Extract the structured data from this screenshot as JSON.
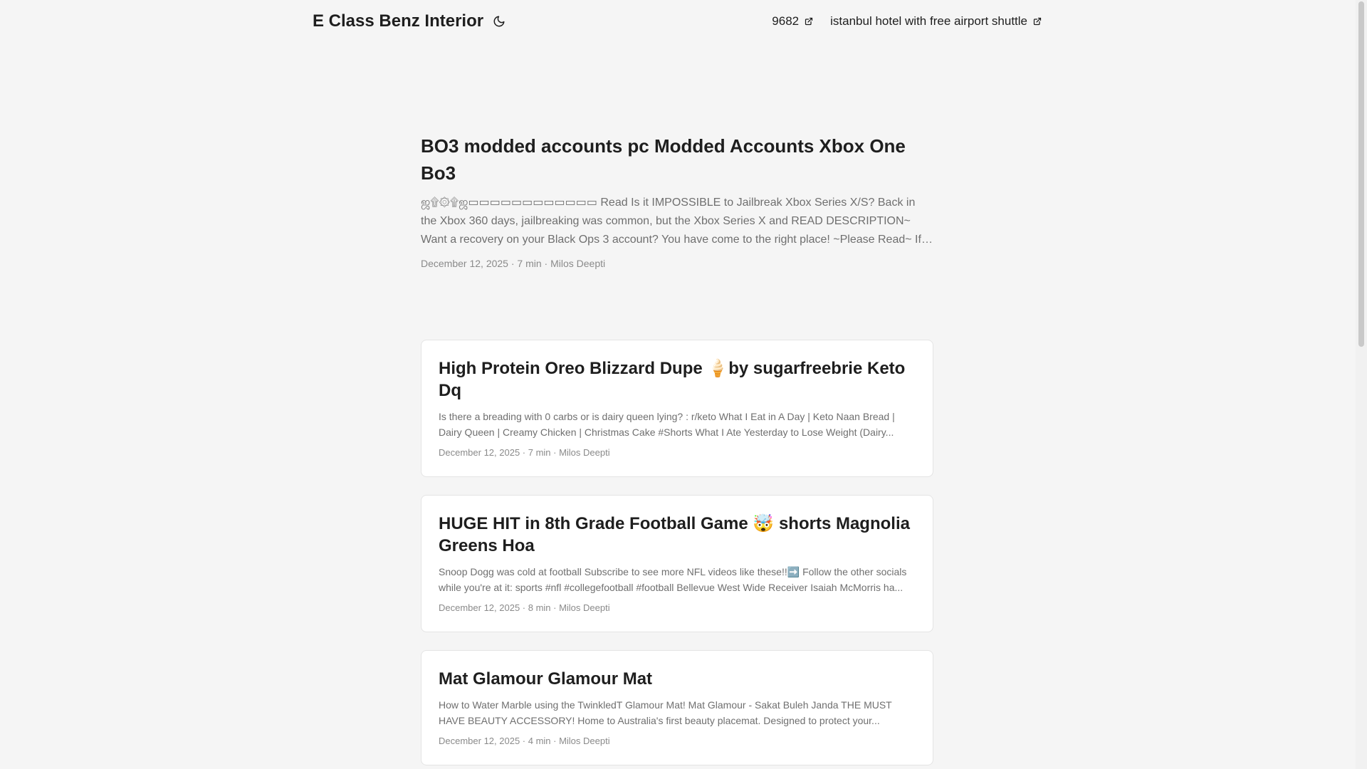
{
  "header": {
    "title": "E Class Benz Interior",
    "theme_icon": "moon-icon",
    "nav": [
      {
        "label": "9682",
        "icon": "external-link-icon"
      },
      {
        "label": "istanbul hotel with free airport shuttle",
        "icon": "external-link-icon"
      }
    ]
  },
  "hero": {
    "title": "BO3 modded accounts pc Modded Accounts Xbox One Bo3",
    "excerpt": "ஜ۩۞۩ஜ▭▭▭▭▭▭▭▭▭▭▭▭ Read Is it IMPOSSIBLE to Jailbreak Xbox Series X/S? Back in the Xbox 360 days, jailbreaking was common, but the Xbox Series X and READ DESCRIPTION~ Want a recovery on your Black Ops 3 account? You have come to the right place! ~Please Read~ If you...",
    "meta": "December 12, 2025 · 7 min · Milos Deepti"
  },
  "posts": [
    {
      "title": "High Protein Oreo Blizzard Dupe 🍦by sugarfreebrie Keto Dq",
      "excerpt": "Is there a breading with 0 carbs or is dairy queen lying? : r/keto What I Eat in A Day | Keto Naan Bread | Dairy Queen | Creamy Chicken | Christmas Cake #Shorts What I Ate Yesterday to Lose Weight (Dairy...",
      "meta": "December 12, 2025 · 7 min · Milos Deepti"
    },
    {
      "title": "HUGE HIT in 8th Grade Football Game 🤯 shorts Magnolia Greens Hoa",
      "excerpt": "Snoop Dogg was cold at football Subscribe to see more NFL videos like these!!➡️ Follow the other socials while you're at it: sports #nfl #collegefootball #football Bellevue West Wide Receiver Isaiah McMorris ha...",
      "meta": "December 12, 2025 · 8 min · Milos Deepti"
    },
    {
      "title": "Mat Glamour Glamour Mat",
      "excerpt": "How to Water Marble using the TwinkledT Glamour Mat! Mat Glamour - Sakat Buleh Janda THE MUST HAVE BEAUTY ACCESSORY! Home to Australia's first beauty placemat. Designed to protect your...",
      "meta": "December 12, 2025 · 4 min · Milos Deepti"
    }
  ],
  "colors": {
    "background": "#f5f5f5",
    "card": "#ffffff",
    "text": "#1e1e1e",
    "muted": "#6f6f6f"
  }
}
